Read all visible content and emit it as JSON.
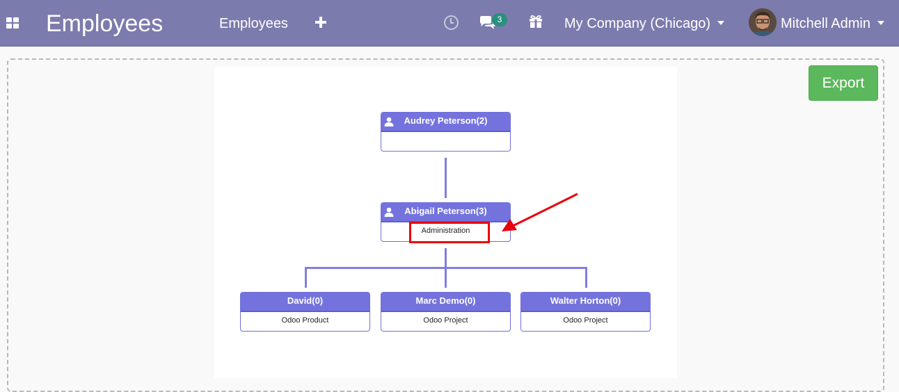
{
  "navbar": {
    "app_title": "Employees",
    "menu_employees": "Employees",
    "chat_count": "3",
    "company": "My Company (Chicago)",
    "user_name": "Mitchell Admin",
    "colors": {
      "bar": "#7c7bad",
      "badge": "#2a8f7d"
    }
  },
  "toolbar": {
    "export_label": "Export"
  },
  "org_chart": {
    "root": {
      "name": "Audrey Peterson(2)",
      "department": ""
    },
    "manager": {
      "name": "Abigail Peterson(3)",
      "department": "Administration"
    },
    "children": [
      {
        "name": "David(0)",
        "department": "Odoo Product"
      },
      {
        "name": "Marc Demo(0)",
        "department": "Odoo Project"
      },
      {
        "name": "Walter Horton(0)",
        "department": "Odoo Project"
      }
    ],
    "colors": {
      "node_header": "#7473dd",
      "connector": "#7f7ee0",
      "annotation": "#e8000b"
    }
  }
}
